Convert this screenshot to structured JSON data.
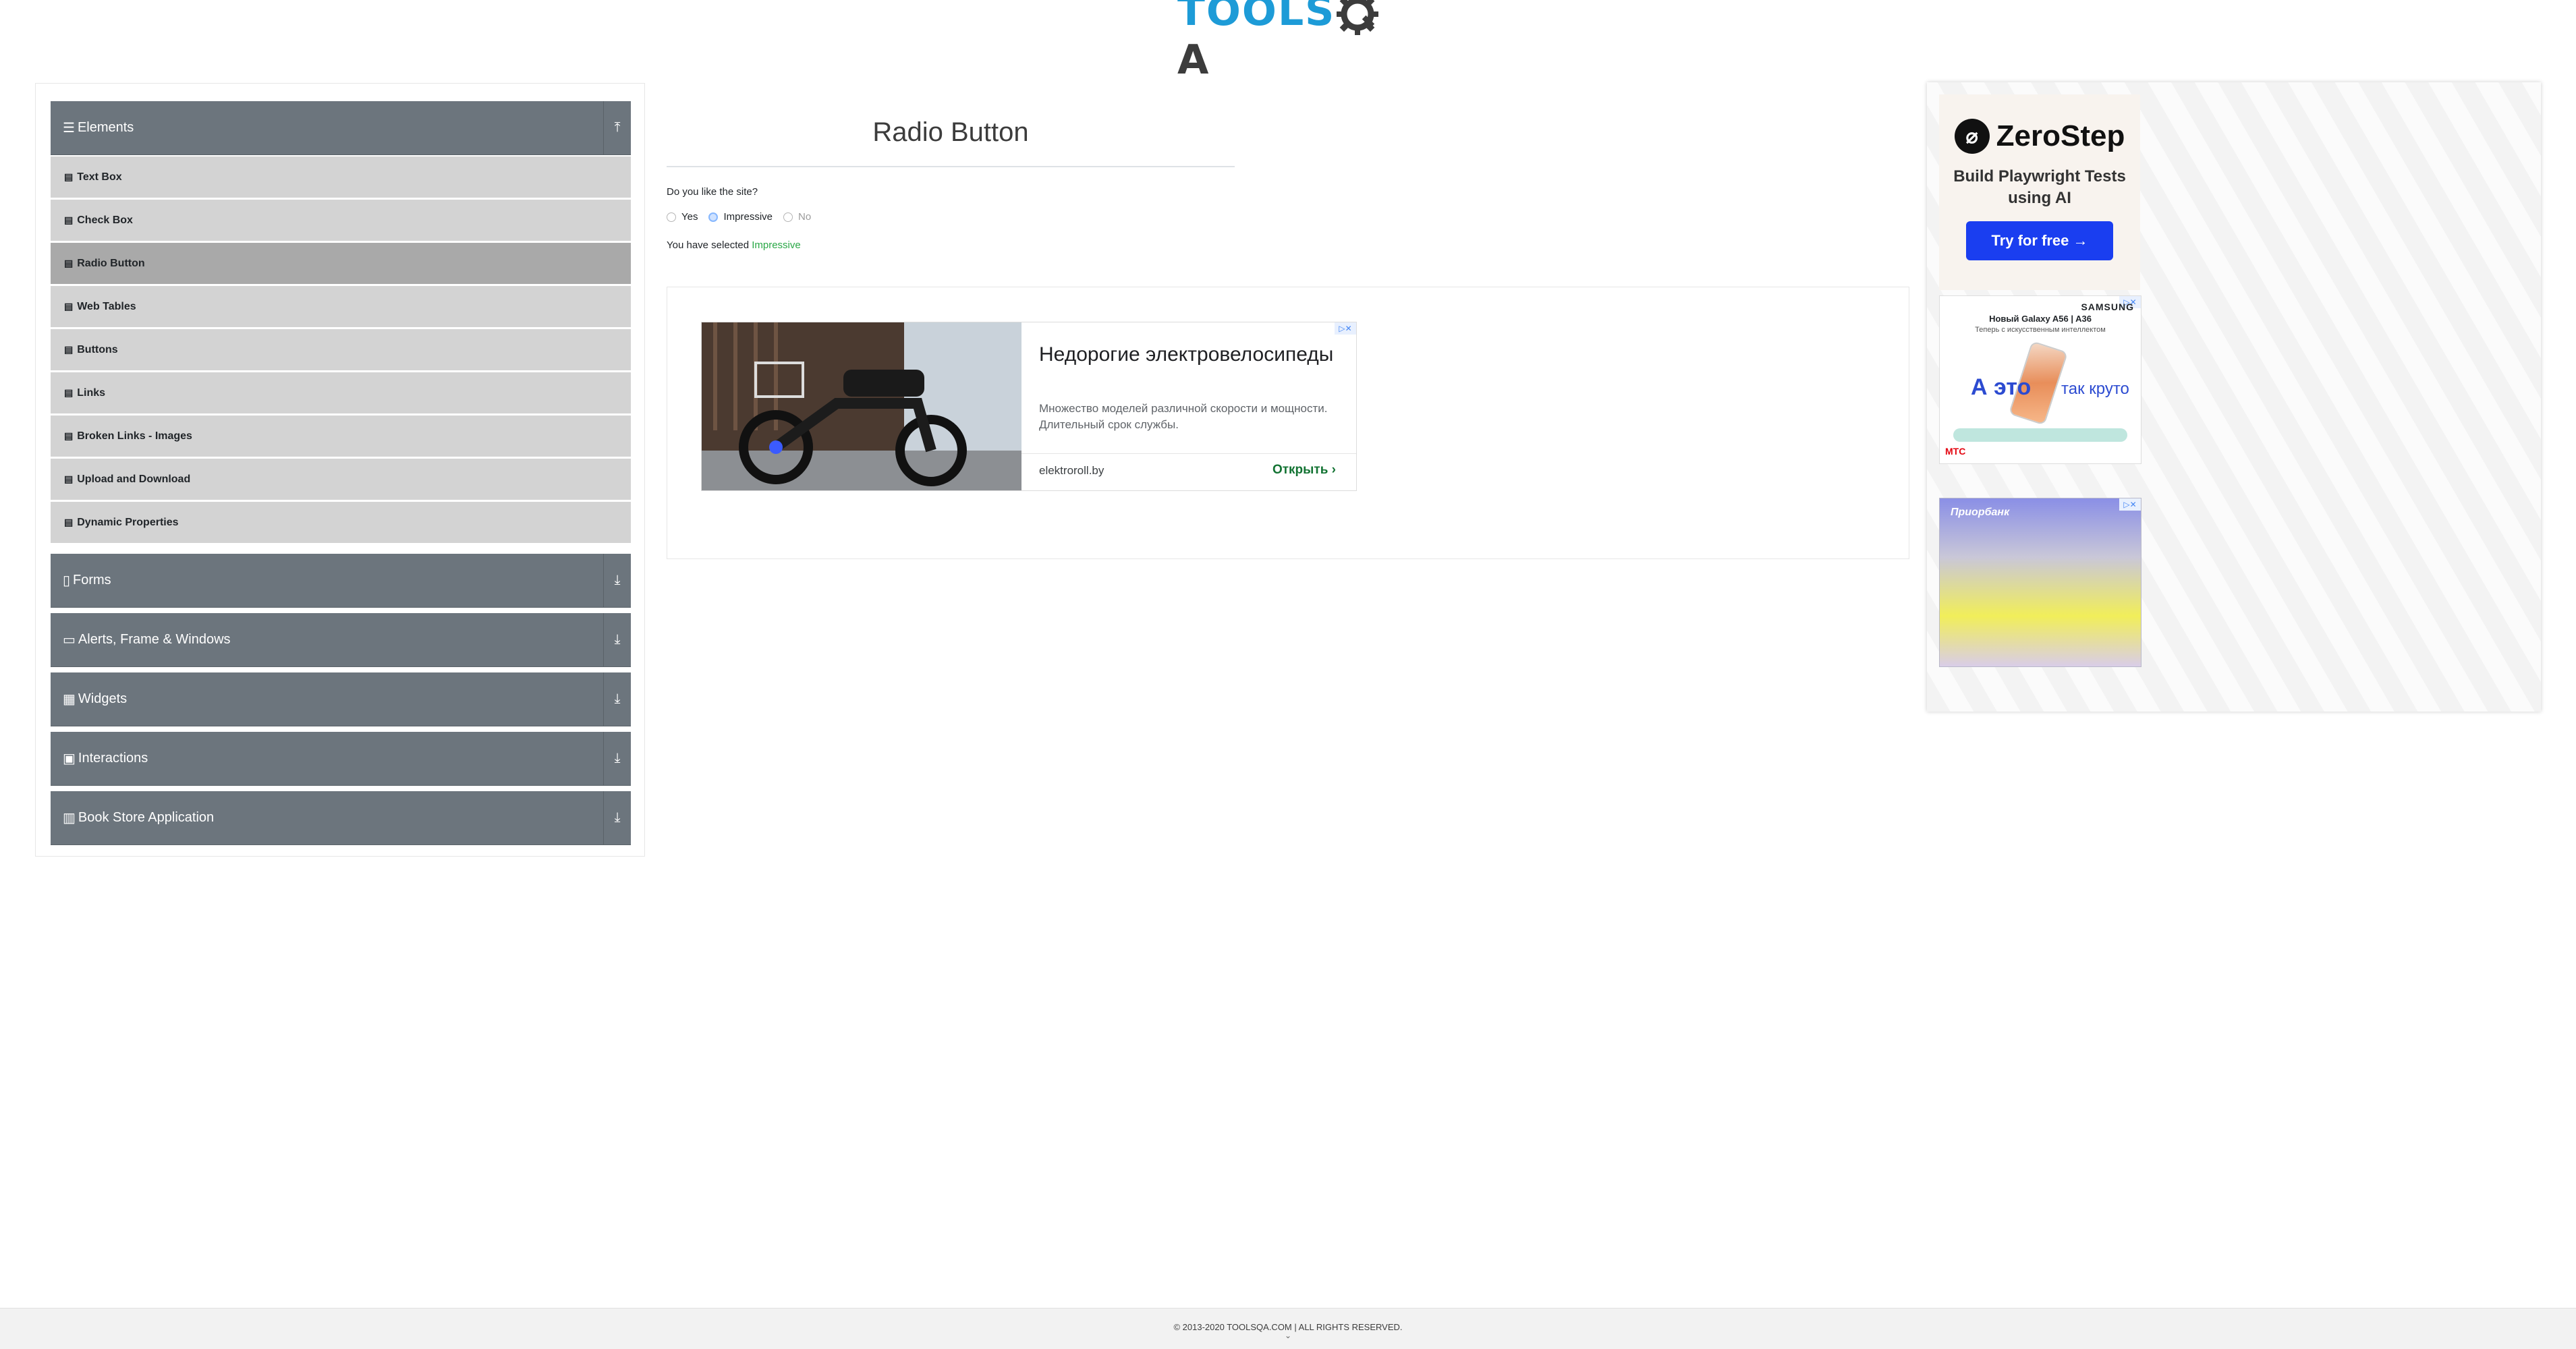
{
  "header": {
    "logo_text_tools": "TOOLS",
    "logo_text_qa": "A"
  },
  "sidebar": {
    "groups": [
      {
        "label": "Elements",
        "icon": "hamburger-icon",
        "arrow": "collapse-up-icon"
      },
      {
        "label": "Forms",
        "icon": "document-icon",
        "arrow": "expand-down-icon"
      },
      {
        "label": "Alerts, Frame & Windows",
        "icon": "window-icon",
        "arrow": "expand-down-icon"
      },
      {
        "label": "Widgets",
        "icon": "grid-icon",
        "arrow": "expand-down-icon"
      },
      {
        "label": "Interactions",
        "icon": "interaction-icon",
        "arrow": "expand-down-icon"
      },
      {
        "label": "Book Store Application",
        "icon": "book-icon",
        "arrow": "expand-down-icon"
      }
    ],
    "items": [
      {
        "label": "Text Box"
      },
      {
        "label": "Check Box"
      },
      {
        "label": "Radio Button",
        "active": true
      },
      {
        "label": "Web Tables"
      },
      {
        "label": "Buttons"
      },
      {
        "label": "Links"
      },
      {
        "label": "Broken Links - Images"
      },
      {
        "label": "Upload and Download"
      },
      {
        "label": "Dynamic Properties"
      }
    ]
  },
  "main": {
    "title": "Radio Button",
    "question": "Do you like the site?",
    "options": [
      {
        "label": "Yes",
        "checked": false,
        "disabled": false
      },
      {
        "label": "Impressive",
        "checked": true,
        "disabled": false
      },
      {
        "label": "No",
        "checked": false,
        "disabled": true
      }
    ],
    "result_prefix": "You have selected ",
    "result_value": "Impressive"
  },
  "ads": {
    "bike": {
      "title": "Недорогие электровелосипеды",
      "description": "Множество моделей различной скорости и мощности. Длительный срок службы.",
      "domain": "elektroroll.by",
      "cta": "Открыть"
    },
    "zerostep": {
      "brand": "ZeroStep",
      "tagline": "Build Playwright Tests using AI",
      "cta": "Try for free →"
    },
    "samsung": {
      "brand": "SAMSUNG",
      "line1": "Новый Galaxy A56 | A36",
      "line2": "Теперь с искусственным интеллектом",
      "big1": "А это",
      "big2": "так круто",
      "operator": "МТС"
    },
    "prior": {
      "brand": "Приорбанк"
    }
  },
  "footer": {
    "copyright": "© 2013-2020 TOOLSQA.COM | ALL RIGHTS RESERVED."
  },
  "colors": {
    "group_header": "#6c757d",
    "menu_item": "#d3d3d3",
    "menu_item_active": "#a9a9a9",
    "selected_text": "#28a745",
    "logo_blue": "#1d9bd7"
  }
}
